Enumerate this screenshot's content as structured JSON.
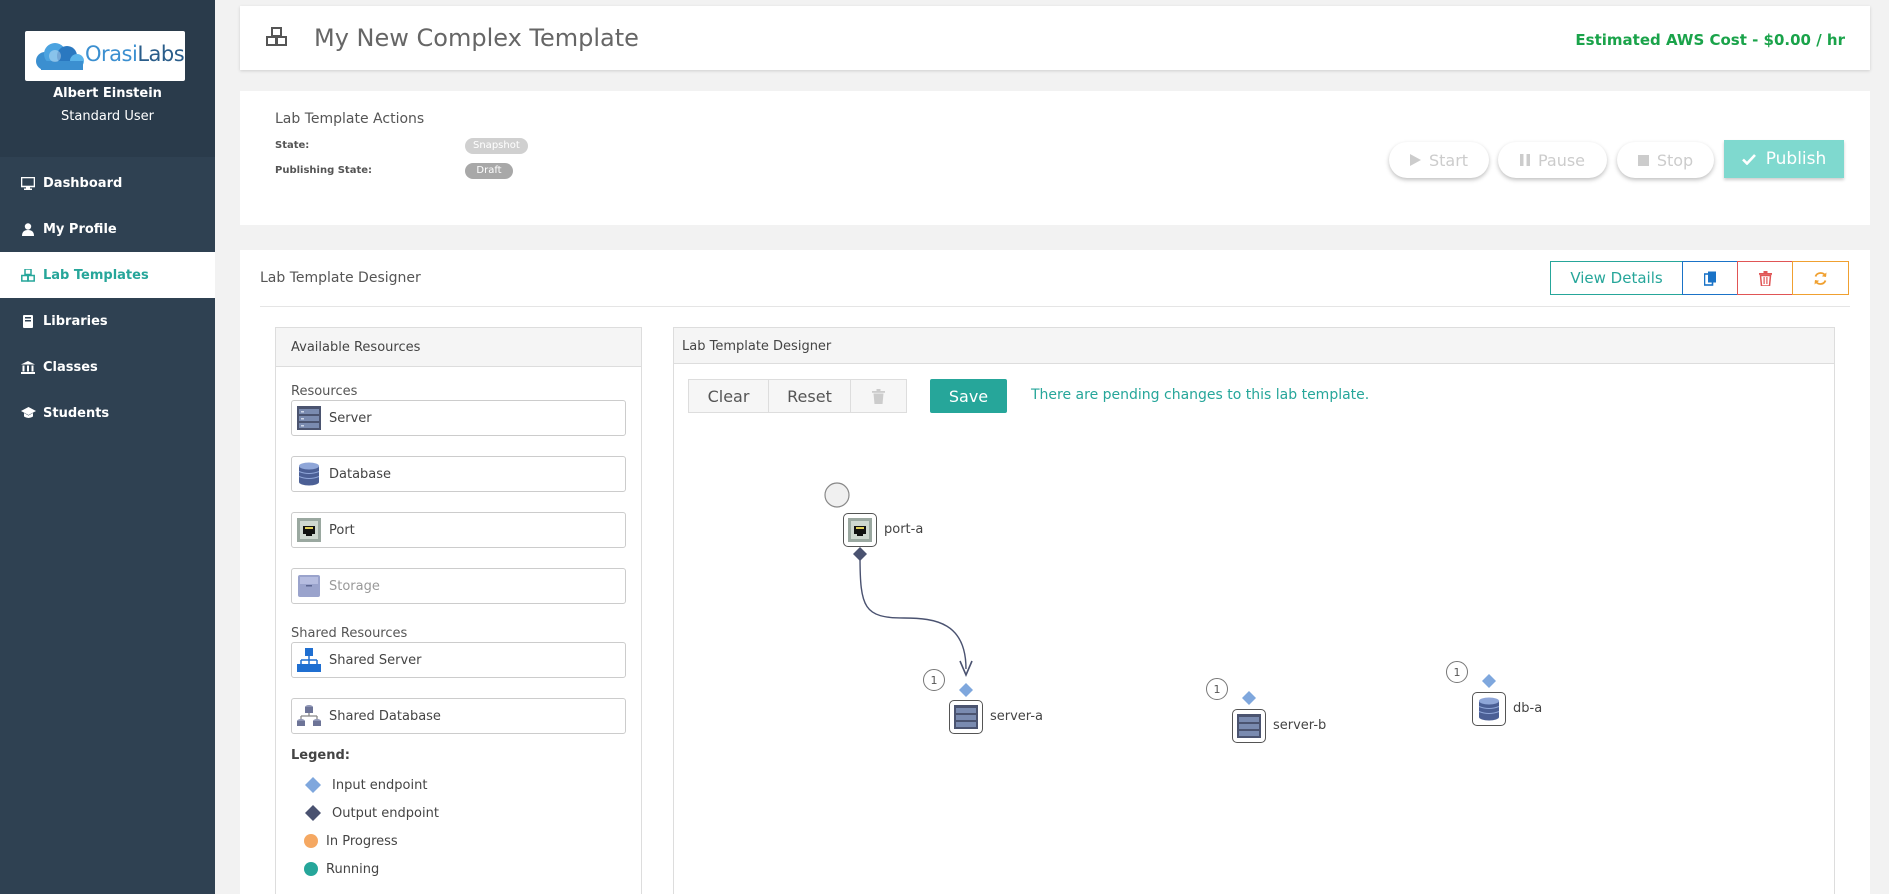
{
  "sidebar": {
    "logo": {
      "prefix": "Orasi",
      "suffix": "Labs"
    },
    "user_name": "Albert Einstein",
    "user_role": "Standard User",
    "items": [
      {
        "label": "Dashboard",
        "icon": "monitor-icon",
        "active": false
      },
      {
        "label": "My Profile",
        "icon": "user-icon",
        "active": false
      },
      {
        "label": "Lab Templates",
        "icon": "cubes-icon",
        "active": true
      },
      {
        "label": "Libraries",
        "icon": "book-icon",
        "active": false
      },
      {
        "label": "Classes",
        "icon": "institution-icon",
        "active": false
      },
      {
        "label": "Students",
        "icon": "graduation-cap-icon",
        "active": false
      }
    ]
  },
  "header": {
    "title": "My New Complex Template",
    "cost": "Estimated AWS Cost - $0.00 / hr"
  },
  "actions": {
    "title": "Lab Template Actions",
    "state_label": "State:",
    "state_value": "Snapshot",
    "publishing_label": "Publishing State:",
    "publishing_value": "Draft",
    "start": "Start",
    "pause": "Pause",
    "stop": "Stop",
    "publish": "Publish"
  },
  "designer": {
    "title": "Lab Template Designer",
    "view_details": "View Details",
    "available": {
      "title": "Available Resources",
      "resources_heading": "Resources",
      "resources": [
        "Server",
        "Database",
        "Port",
        "Storage"
      ],
      "shared_heading": "Shared Resources",
      "shared": [
        "Shared Server",
        "Shared Database"
      ],
      "legend_title": "Legend:",
      "legend": [
        "Input endpoint",
        "Output endpoint",
        "In Progress",
        "Running"
      ]
    },
    "canvas": {
      "title": "Lab Template Designer",
      "clear": "Clear",
      "reset": "Reset",
      "save": "Save",
      "pending": "There are pending changes to this lab template.",
      "nodes": [
        {
          "label": "port-a"
        },
        {
          "label": "server-a",
          "badge": "1"
        },
        {
          "label": "server-b",
          "badge": "1"
        },
        {
          "label": "db-a",
          "badge": "1"
        }
      ]
    }
  },
  "colors": {
    "sidebar": "#2f4152",
    "accent": "#26a69a",
    "cost": "#1aa34a",
    "input_endpoint": "#7fa7dd",
    "output_endpoint": "#4a5270",
    "in_progress": "#f5a862",
    "running": "#26a69a"
  }
}
